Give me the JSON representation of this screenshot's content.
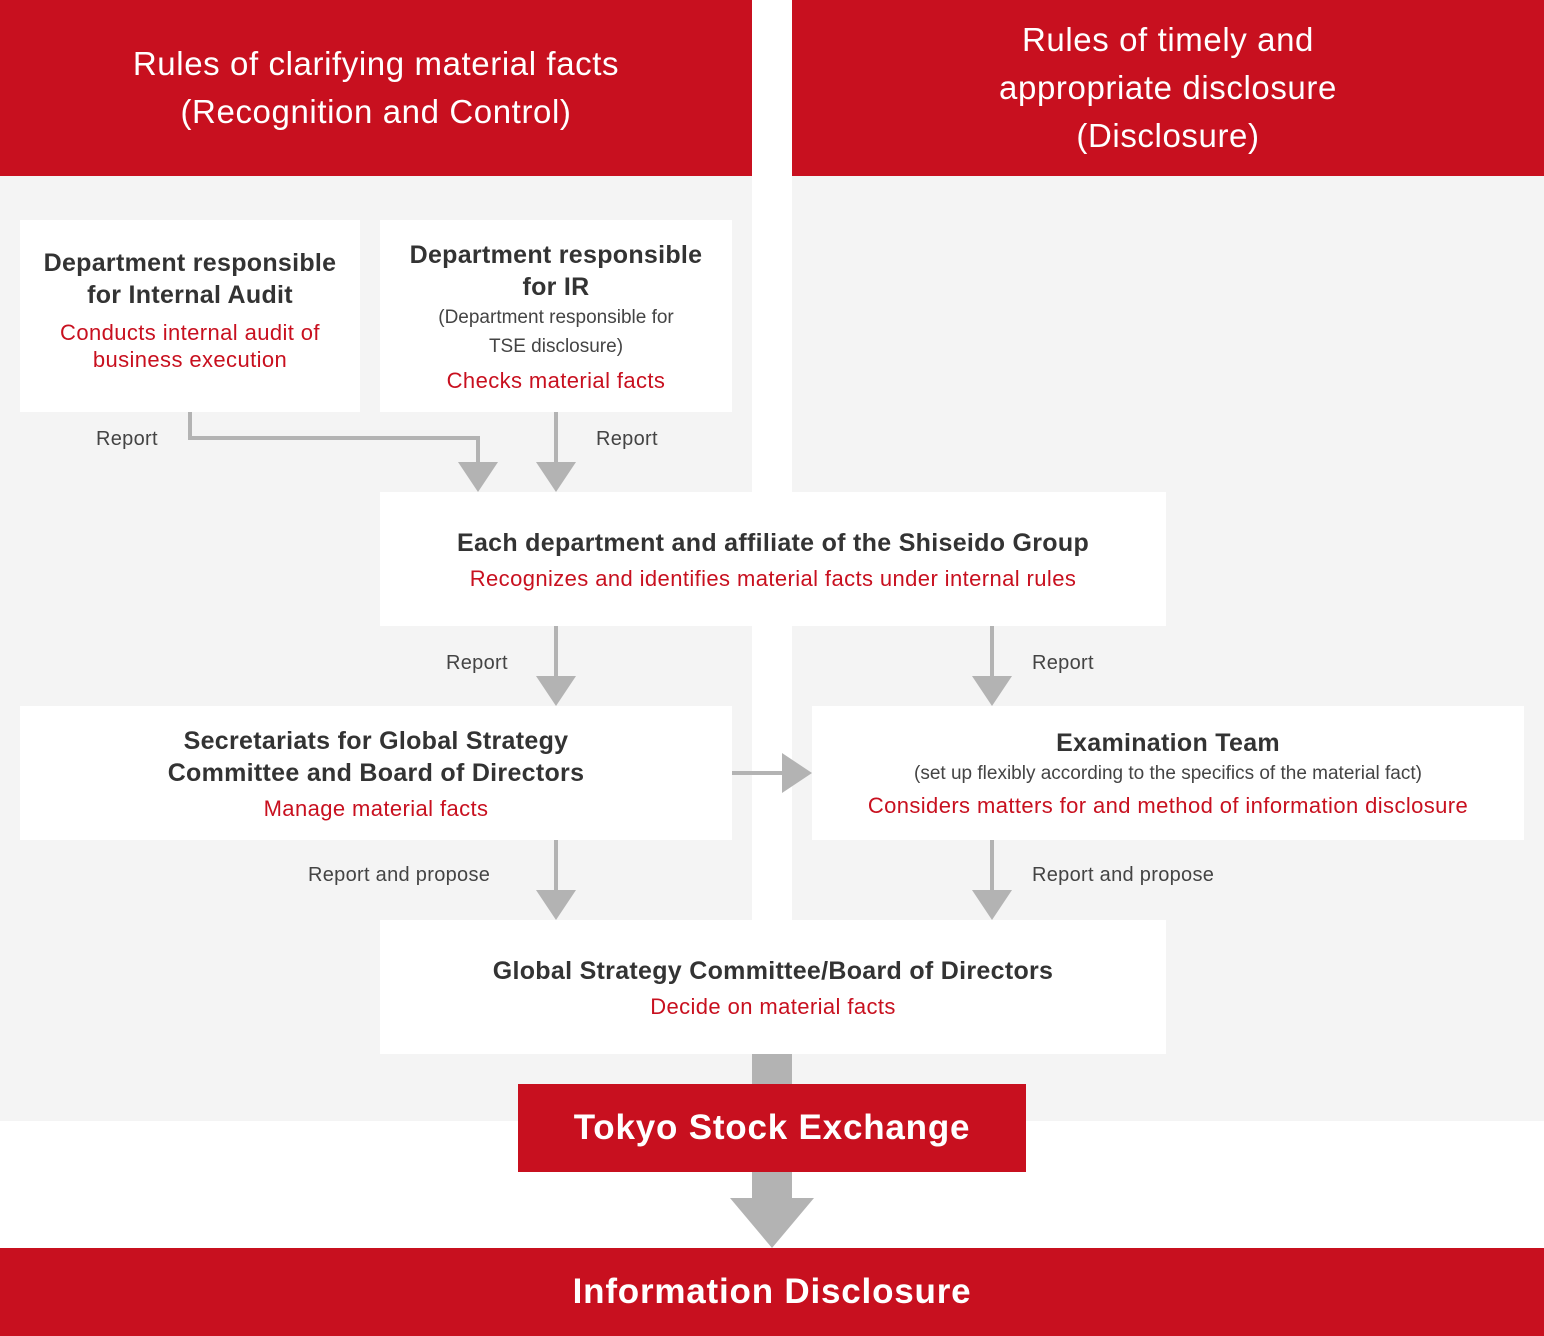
{
  "headers": {
    "left": {
      "line1": "Rules of clarifying material facts",
      "line2": "(Recognition and Control)"
    },
    "right": {
      "line1": "Rules of timely and",
      "line2": "appropriate disclosure",
      "line3": "(Disclosure)"
    }
  },
  "nodes": {
    "internal_audit": {
      "title_line1": "Department responsible",
      "title_line2": "for Internal Audit",
      "role_line1": "Conducts internal audit of",
      "role_line2": "business execution"
    },
    "ir": {
      "title_line1": "Department responsible",
      "title_line2": "for IR",
      "note_line1": "(Department responsible for",
      "note_line2": "TSE disclosure)",
      "role": "Checks material facts"
    },
    "each_department": {
      "title": "Each department and affiliate of the Shiseido Group",
      "role": "Recognizes and identifies material facts under internal rules"
    },
    "secretariats": {
      "title_line1": "Secretariats for Global Strategy",
      "title_line2": "Committee and Board of Directors",
      "role": "Manage material facts"
    },
    "examination_team": {
      "title": "Examination Team",
      "note": "(set up flexibly according to the specifics of the material fact)",
      "role": "Considers matters for and method of information disclosure"
    },
    "committee": {
      "title": "Global Strategy Committee/Board of Directors",
      "role": "Decide on material facts"
    },
    "tse": {
      "label": "Tokyo Stock Exchange"
    },
    "disclosure": {
      "label": "Information Disclosure"
    }
  },
  "edge_labels": {
    "audit_report": "Report",
    "ir_report": "Report",
    "dept_to_secretariats": "Report",
    "dept_to_exam": "Report",
    "secretariats_to_committee": "Report and propose",
    "exam_to_committee": "Report and propose"
  },
  "colors": {
    "accent_red": "#c8101f",
    "panel_gray": "#f4f4f4",
    "arrow_gray": "#b3b3b3",
    "text_dark": "#333333"
  }
}
